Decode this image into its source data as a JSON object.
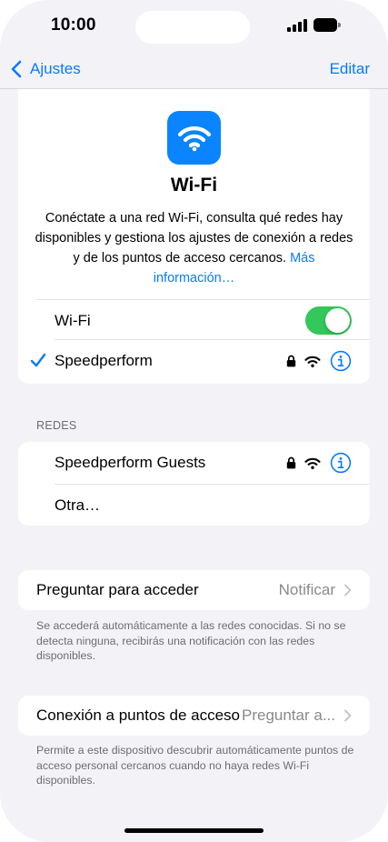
{
  "status_bar": {
    "time": "10:00"
  },
  "nav": {
    "back_label": "Ajustes",
    "edit_label": "Editar"
  },
  "hero": {
    "title": "Wi-Fi",
    "description": "Conéctate a una red Wi-Fi, consulta qué redes hay disponibles y gestiona los ajustes de conexión a redes y de los puntos de acceso cercanos.",
    "more_link": "Más información…"
  },
  "wifi_toggle": {
    "label": "Wi-Fi",
    "on": true
  },
  "connected_network": {
    "name": "Speedperform",
    "secured": true
  },
  "networks_section": {
    "header": "REDES",
    "items": [
      {
        "name": "Speedperform Guests",
        "secured": true
      },
      {
        "name": "Otra…"
      }
    ]
  },
  "ask_to_join": {
    "label": "Preguntar para acceder",
    "value": "Notificar",
    "footnote": "Se accederá automáticamente a las redes conocidas. Si no se detecta ninguna, recibirás una notificación con las redes disponibles."
  },
  "hotspot": {
    "label": "Conexión a puntos de acceso",
    "value": "Preguntar a...",
    "footnote": "Permite a este dispositivo descubrir automáticamente puntos de acceso personal cercanos cuando no haya redes Wi-Fi disponibles."
  },
  "colors": {
    "accent": "#0a7aff",
    "toggle_on": "#34c759",
    "wifi_icon_bg": "#0a84ff"
  },
  "icons": {
    "back": "chevron-left-icon",
    "check": "checkmark-icon",
    "lock": "lock-icon",
    "wifi": "wifi-icon",
    "info": "info-circle-icon",
    "disclosure": "chevron-right-icon"
  }
}
